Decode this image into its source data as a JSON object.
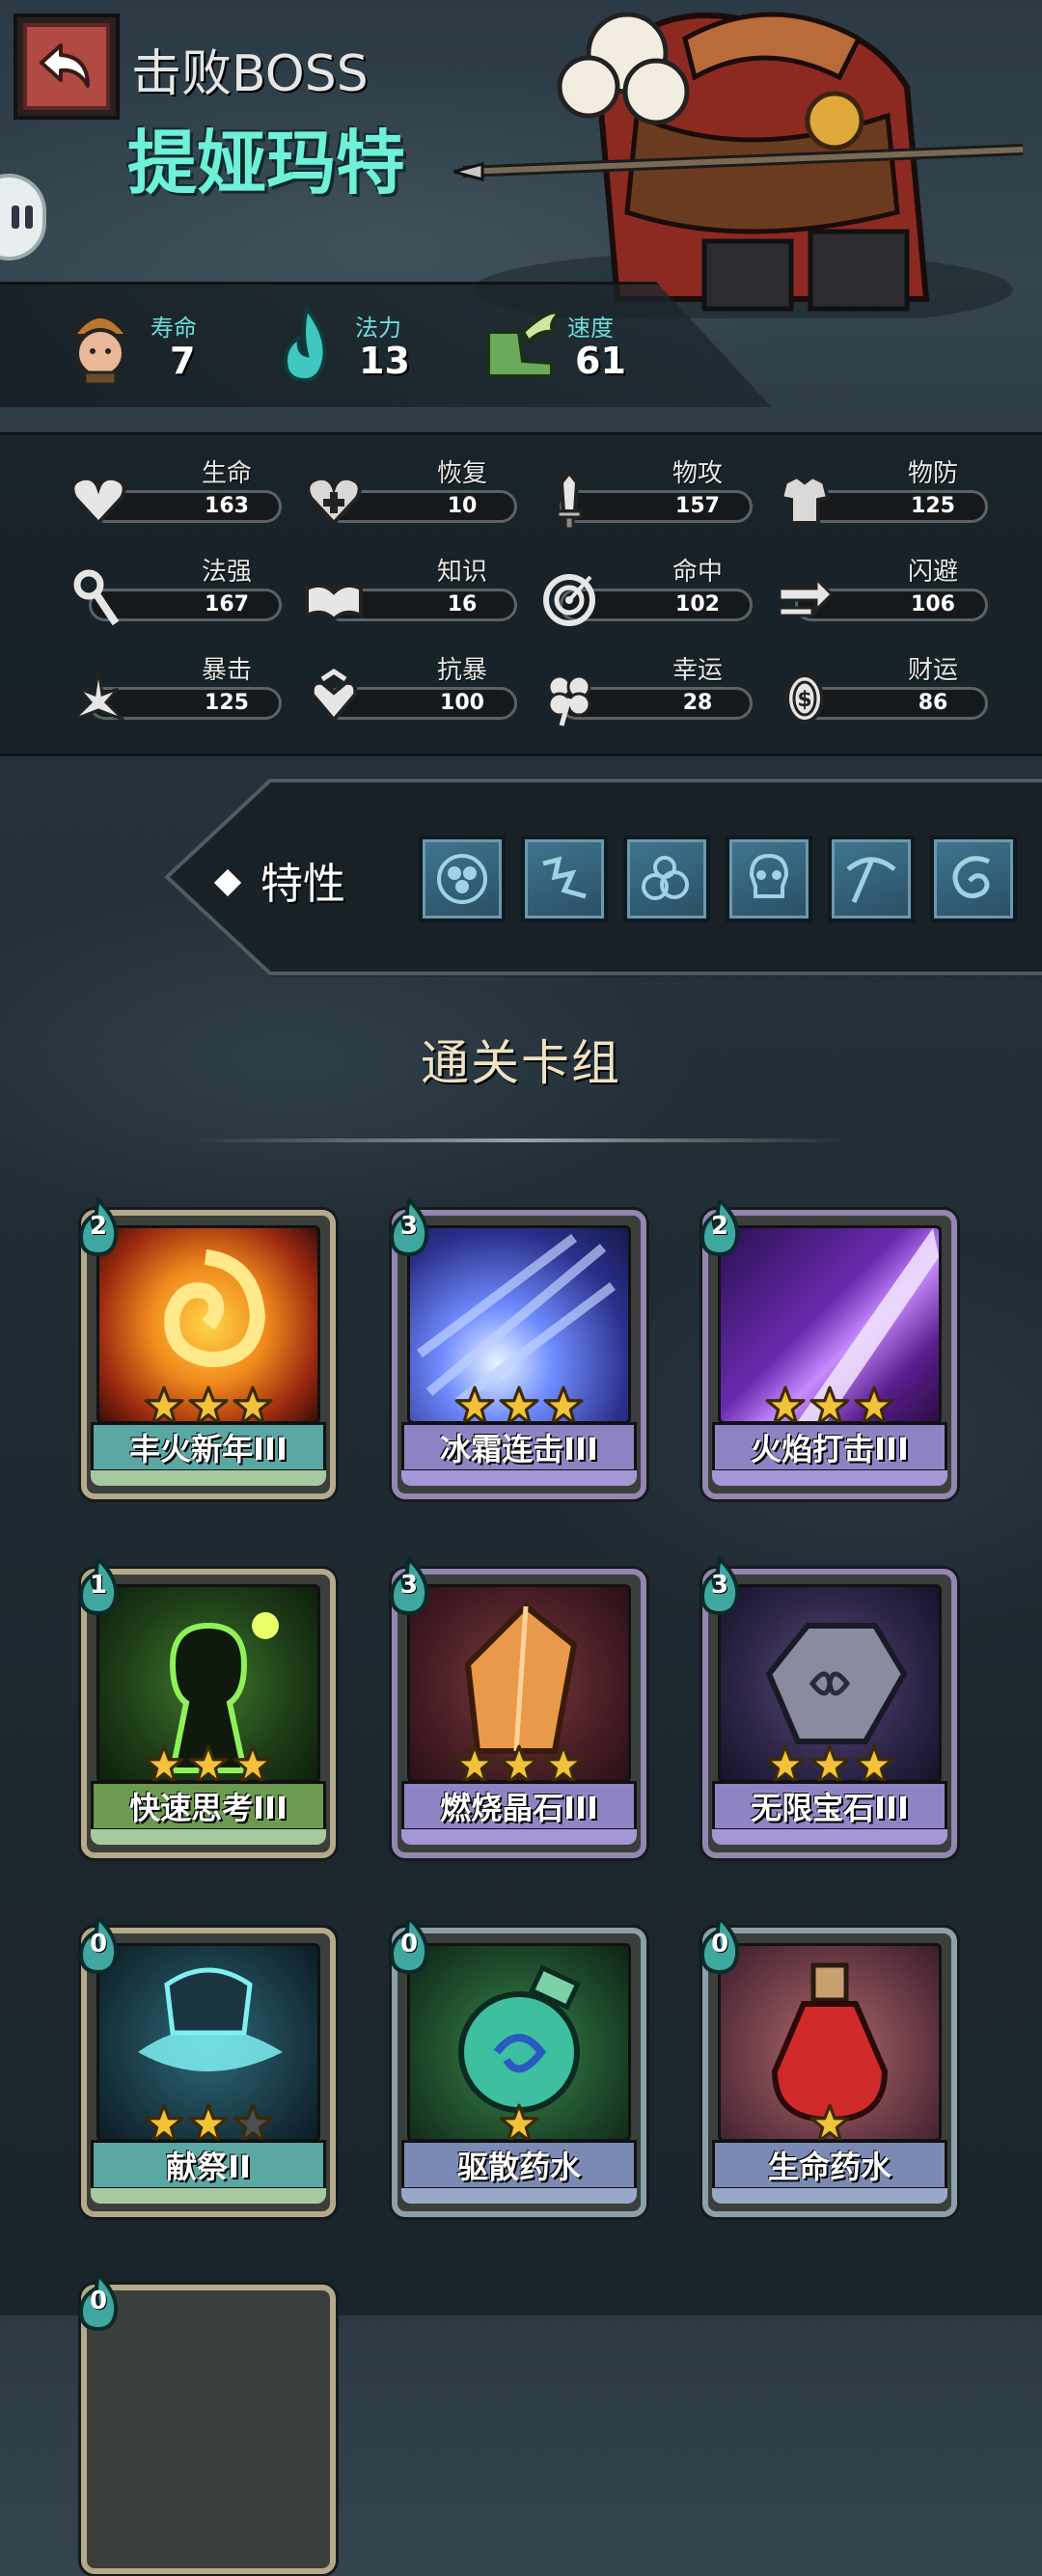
{
  "header": {
    "title": "击败BOSS",
    "boss_name": "提娅玛特"
  },
  "top_stats": [
    {
      "label": "寿命",
      "value": "7",
      "icon": "adventurer-icon"
    },
    {
      "label": "法力",
      "value": "13",
      "icon": "mana-flame-icon"
    },
    {
      "label": "速度",
      "value": "61",
      "icon": "winged-boot-icon"
    }
  ],
  "attributes": [
    {
      "label": "生命",
      "value": "163",
      "icon": "heart-icon"
    },
    {
      "label": "恢复",
      "value": "10",
      "icon": "heal-heart-icon"
    },
    {
      "label": "物攻",
      "value": "157",
      "icon": "sword-icon"
    },
    {
      "label": "物防",
      "value": "125",
      "icon": "armor-icon"
    },
    {
      "label": "法强",
      "value": "167",
      "icon": "staff-icon"
    },
    {
      "label": "知识",
      "value": "16",
      "icon": "book-icon"
    },
    {
      "label": "命中",
      "value": "102",
      "icon": "target-icon"
    },
    {
      "label": "闪避",
      "value": "106",
      "icon": "dodge-arrows-icon"
    },
    {
      "label": "暴击",
      "value": "125",
      "icon": "crit-icon"
    },
    {
      "label": "抗暴",
      "value": "100",
      "icon": "crit-resist-icon"
    },
    {
      "label": "幸运",
      "value": "28",
      "icon": "clover-icon"
    },
    {
      "label": "财运",
      "value": "86",
      "icon": "coin-icon"
    }
  ],
  "traits": {
    "label": "特性",
    "icons": [
      "clover-rune-icon",
      "lightning-rune-icon",
      "rock-pile-icon",
      "skull-icon",
      "pickaxe-icon",
      "swirl-rune-icon"
    ]
  },
  "deck": {
    "title": "通关卡组",
    "cards": [
      {
        "name": "丰火新年III",
        "cost": "2",
        "stars": 3,
        "max_stars": 3,
        "tier": "gold",
        "art": "fire-spiral"
      },
      {
        "name": "冰霜连击III",
        "cost": "3",
        "stars": 3,
        "max_stars": 3,
        "tier": "purple",
        "art": "frost-burst"
      },
      {
        "name": "火焰打击III",
        "cost": "2",
        "stars": 3,
        "max_stars": 3,
        "tier": "purple",
        "art": "violet-slash"
      },
      {
        "name": "快速思考III",
        "cost": "1",
        "stars": 3,
        "max_stars": 3,
        "tier": "gold",
        "art": "green-thinker"
      },
      {
        "name": "燃烧晶石III",
        "cost": "3",
        "stars": 3,
        "max_stars": 3,
        "tier": "purple",
        "art": "amber-crystal"
      },
      {
        "name": "无限宝石III",
        "cost": "3",
        "stars": 3,
        "max_stars": 3,
        "tier": "purple",
        "art": "infinity-gem"
      },
      {
        "name": "献祭II",
        "cost": "0",
        "stars": 2,
        "max_stars": 3,
        "tier": "gold",
        "art": "sacrifice-spirit"
      },
      {
        "name": "驱散药水",
        "cost": "0",
        "stars": 1,
        "max_stars": 1,
        "tier": "blue",
        "art": "dispel-potion"
      },
      {
        "name": "生命药水",
        "cost": "0",
        "stars": 1,
        "max_stars": 1,
        "tier": "blue",
        "art": "life-potion"
      },
      {
        "name": "",
        "cost": "0",
        "stars": 0,
        "max_stars": 0,
        "tier": "gold",
        "art": "partial"
      }
    ]
  },
  "colors": {
    "accent_teal": "#6ff0d8",
    "mana_teal": "#3fc7c0",
    "star_gold": "#f2c23a",
    "back_red": "#b04a42"
  }
}
